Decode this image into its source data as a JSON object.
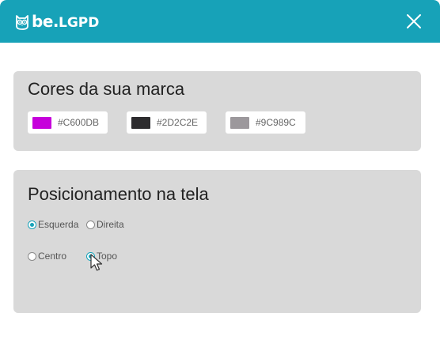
{
  "header": {
    "brand_main": "be.",
    "brand_suffix": "LGPD",
    "logo_icon": "owl-logo-icon",
    "close_icon": "close-icon",
    "bar_color": "#17a2b8"
  },
  "colors_section": {
    "title": "Cores da sua marca",
    "swatches": [
      {
        "hex": "#C600DB",
        "color": "#C600DB"
      },
      {
        "hex": "#2D2C2E",
        "color": "#2D2C2E"
      },
      {
        "hex": "#9C989C",
        "color": "#9C989C"
      }
    ]
  },
  "position_section": {
    "title": "Posicionamento na tela",
    "options": [
      {
        "label": "Esquerda",
        "checked": true
      },
      {
        "label": "Direita",
        "checked": false
      },
      {
        "label": "Centro",
        "checked": false
      },
      {
        "label": "Topo",
        "checked": true
      }
    ]
  },
  "pointer": {
    "icon": "mouse-pointer-icon"
  }
}
